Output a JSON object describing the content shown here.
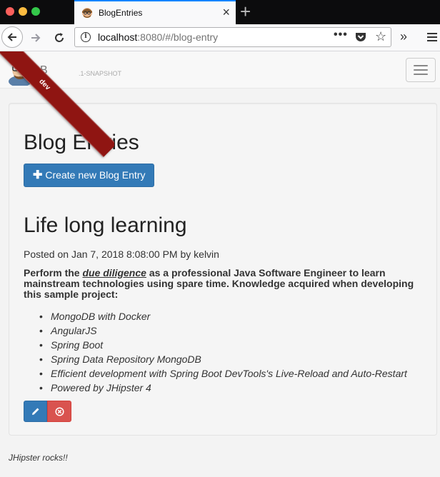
{
  "browser": {
    "tab_title": "BlogEntries",
    "url_host": "localhost",
    "url_path": ":8080/#/blog-entry"
  },
  "app": {
    "brand": "B",
    "version": ".1-SNAPSHOT",
    "ribbon": "dev"
  },
  "page": {
    "title": "Blog Entries",
    "create_label": "Create new Blog Entry"
  },
  "entry": {
    "title": "Life long learning",
    "posted": "Posted on Jan 7, 2018 8:08:00 PM by kelvin",
    "summary_before": "Perform the ",
    "summary_emph": "due diligence",
    "summary_after": " as a professional Java Software Engineer to learn mainstream technologies using spare time. Knowledge acquired when developing this sample project:",
    "bullets": [
      "MongoDB with Docker",
      "AngularJS",
      "Spring Boot",
      "Spring Data Repository MongoDB",
      "Efficient development with Spring Boot DevTools's Live-Reload and Auto-Restart",
      "Powered by JHipster 4"
    ]
  },
  "footer": {
    "text": "JHipster rocks!!"
  }
}
